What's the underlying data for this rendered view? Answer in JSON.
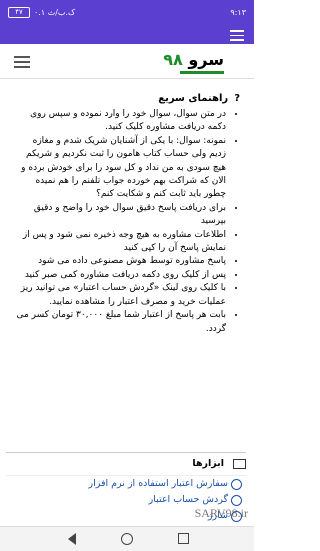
{
  "status": {
    "time": "۹:۱۳",
    "network": "۰.۱ ک.ب/ث",
    "battery": "۴۷"
  },
  "header": {
    "logo_text": "سرو",
    "logo_num": "۹۸"
  },
  "guide": {
    "title": "راهنمای سریع",
    "items": [
      "در متن سوال، سوال خود را وارد نموده و سپس روی دکمه دریافت مشاوره کلیک کنید.",
      "نمونه: سوال: با یکی از آشنایان شریک شدم و مغازه زدیم ولی حساب کتاب هامون را ثبت نکردیم و شریکم هیچ سودی به من نداد و کل سود را برای خودش برده و الان که شراکت بهم خورده جواب تلفنم را هم نمیده چطور باید ثابت کنم و شکایت کنم؟",
      "برای دریافت پاسخ دقیق سوال خود را واضح و دقیق بپرسید",
      "اطلاعات مشاوره به هیچ وجه ذخیره نمی شود و پس از نمایش پاسخ آن را کپی کنید",
      "پاسخ مشاوره توسط هوش مصنوعی داده می شود",
      "پس از کلیک روی دکمه دریافت مشاوره کمی صبر کنید",
      "با کلیک روی لینک «گردش حساب اعتبار» می توانید ریز عملیات خرید و مصرف اعتبار را مشاهده نمایید.",
      "بابت هر پاسخ از اعتبار شما مبلغ ۳۰,۰۰۰ تومان کسر می گردد."
    ]
  },
  "tools": {
    "title": "ابزارها",
    "items": [
      "سفارش اعتبار استفاده از نرم افزار",
      "گردش حساب اعتبار",
      "شارژ"
    ]
  },
  "watermark": "SARV98.ir"
}
